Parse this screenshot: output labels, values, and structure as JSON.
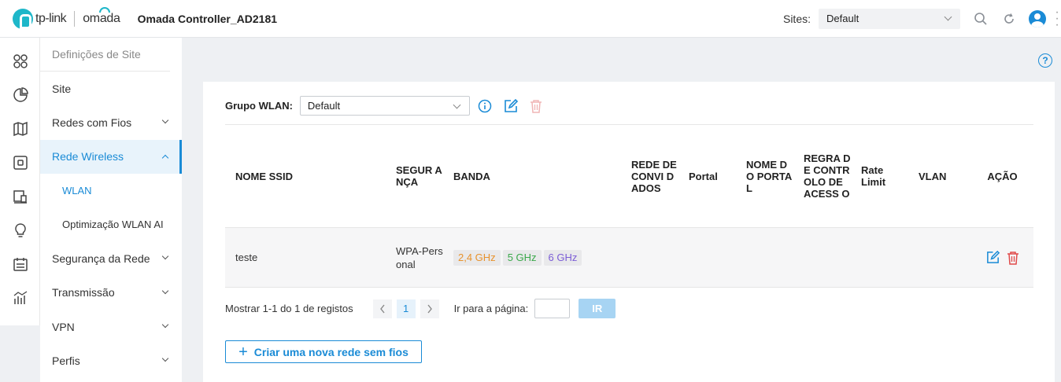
{
  "brand": {
    "tp_link": "tp-link",
    "omada": "omada"
  },
  "app_title": "Omada Controller_AD2181",
  "topbar": {
    "sites_label": "Sites:",
    "sites_value": "Default"
  },
  "menu": {
    "header": "Definições de Site",
    "items": [
      {
        "label": "Site"
      },
      {
        "label": "Redes com Fios"
      },
      {
        "label": "Rede Wireless"
      },
      {
        "label": "WLAN"
      },
      {
        "label": "Optimização WLAN AI"
      },
      {
        "label": "Segurança da Rede"
      },
      {
        "label": "Transmissão"
      },
      {
        "label": "VPN"
      },
      {
        "label": "Perfis"
      }
    ]
  },
  "wlan_group": {
    "label": "Grupo WLAN:",
    "value": "Default"
  },
  "table": {
    "headers": [
      "NOME SSID",
      "SEGUR ANÇA",
      "BANDA",
      "REDE DE CONVI DADOS",
      "Portal",
      "NOME DO PORTA L",
      "REGRA DE CONTR OLO DE ACESS O",
      "Rate Limit",
      "VLAN",
      "AÇÃO"
    ],
    "rows": [
      {
        "ssid": "teste",
        "security": "WPA-Personal",
        "bands": [
          "2,4 GHz",
          "5 GHz",
          "6 GHz"
        ]
      }
    ]
  },
  "band_colors": {
    "b24": "#e8922c",
    "b5": "#3aa84a",
    "b6": "#7b5cd6"
  },
  "pagination": {
    "summary": "Mostrar 1-1 do 1 de registos",
    "page": "1",
    "goto_label": "Ir para a página:",
    "go": "IR"
  },
  "create_button": "Criar uma nova rede sem fios",
  "colors": {
    "accent": "#1a8bd6",
    "brand": "#1eb7c9",
    "delete": "#e04a4a"
  }
}
